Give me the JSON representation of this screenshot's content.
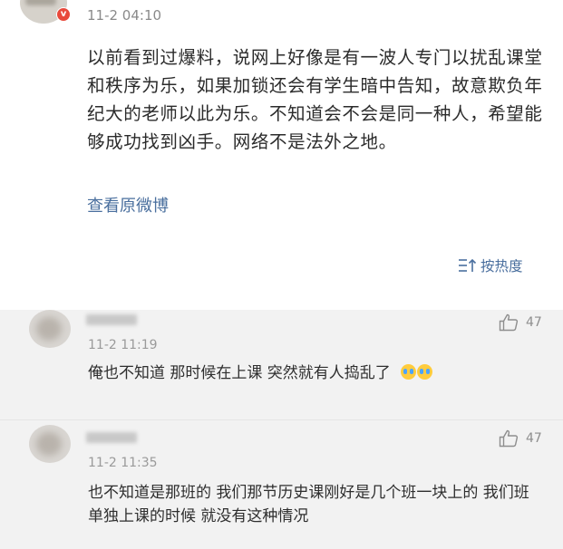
{
  "post": {
    "time": "11-2 04:10",
    "verified_mark": "v",
    "text": "以前看到过爆料，说网上好像是有一波人专门以扰乱课堂和秩序为乐，如果加锁还会有学生暗中告知，故意欺负年纪大的老师以此为乐。不知道会不会是同一种人，希望能够成功找到凶手。网络不是法外之地。",
    "view_original": "查看原微博",
    "sort_label": "按热度"
  },
  "comments": [
    {
      "time": "11-2 11:19",
      "text": "俺也不知道 那时候在上课 突然就有人捣乱了",
      "emoji": "crying-laughing-icon",
      "likes": "47"
    },
    {
      "time": "11-2 11:35",
      "text": "也不知道是那班的 我们那节历史课刚好是几个班一块上的 我们班单独上课的时候 就没有这种情况",
      "likes": "47"
    }
  ],
  "colors": {
    "link": "#4a6f9e",
    "comment_bg": "#f2f2f2",
    "verified_badge": "#e8493b"
  }
}
